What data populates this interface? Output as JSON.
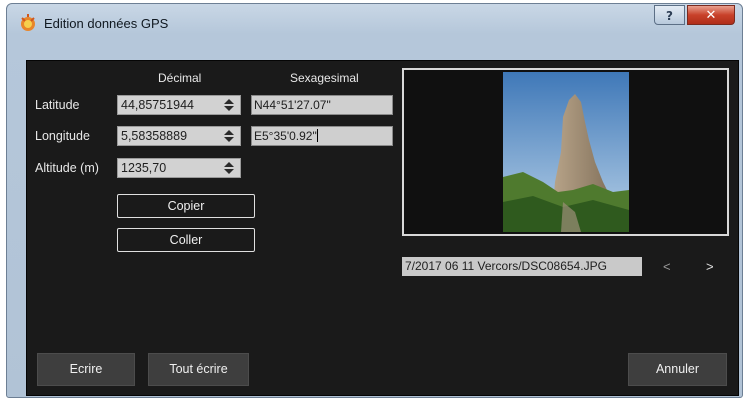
{
  "window": {
    "title": "Edition données GPS",
    "help_label": "?",
    "close_label": "✕"
  },
  "headers": {
    "decimal": "Décimal",
    "sexagesimal": "Sexagesimal"
  },
  "fields": {
    "latitude": {
      "label": "Latitude",
      "decimal": "44,85751944",
      "sexagesimal": "N44°51'27.07\""
    },
    "longitude": {
      "label": "Longitude",
      "decimal": "5,58358889",
      "sexagesimal": "E5°35'0.92\""
    },
    "altitude": {
      "label": "Altitude (m)",
      "decimal": "1235,70"
    }
  },
  "buttons": {
    "copy": "Copier",
    "paste": "Coller",
    "write": "Ecrire",
    "write_all": "Tout écrire",
    "cancel": "Annuler"
  },
  "file": {
    "path": "7/2017 06 11 Vercors/DSC08654.JPG"
  },
  "nav": {
    "prev": "<",
    "next": ">"
  },
  "icons": {
    "app": "app-icon",
    "spin": "spin-arrows-icon"
  },
  "colors": {
    "client_bg": "#1a1a1a",
    "title_bar": "#b5c7da",
    "close": "#c8412a",
    "field": "#d2d2d2"
  }
}
